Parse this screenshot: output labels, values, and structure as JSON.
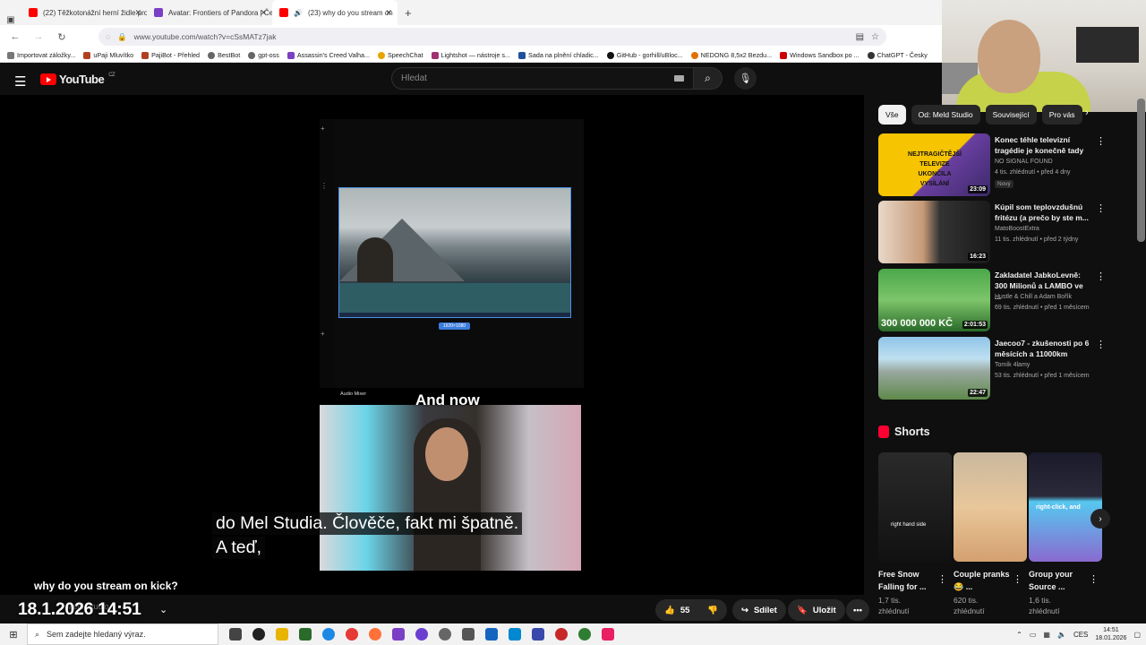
{
  "browser": {
    "tabs": [
      {
        "label": "(22) Těžkotonážní herní židle pro",
        "color": "#ff0000",
        "active": false
      },
      {
        "label": "Avatar: Frontiers of Pandora | Če",
        "color": "#7a3fc4",
        "active": false
      },
      {
        "label": "(23) why do you stream on",
        "color": "#ff0000",
        "active": true
      }
    ],
    "new_tab": "+",
    "url": "www.youtube.com/watch?v=cSsMATz7jak",
    "bookmarks": [
      {
        "label": "Importovat záložky...",
        "color": "#777"
      },
      {
        "label": "uPaji Mluvítko",
        "color": "#b04020"
      },
      {
        "label": "PajiBot - Přehled",
        "color": "#b04020"
      },
      {
        "label": "BestBot",
        "color": "#666"
      },
      {
        "label": "gpt-oss",
        "color": "#666"
      },
      {
        "label": "Assassin's Creed Valha...",
        "color": "#7a3fc4"
      },
      {
        "label": "SpeechChat",
        "color": "#e8a400"
      },
      {
        "label": "Lightshot — nástroje s...",
        "color": "#a03070"
      },
      {
        "label": "Sada na plnění chladic...",
        "color": "#2050a0"
      },
      {
        "label": "GitHub - gorhill/uBloc...",
        "color": "#111"
      },
      {
        "label": "NEDONG 8,5x2 Bezdu...",
        "color": "#e07000"
      },
      {
        "label": "Windows Sandbox po ...",
        "color": "#c00"
      },
      {
        "label": "ChatGPT - Česky",
        "color": "#333"
      }
    ]
  },
  "youtube": {
    "logo": "YouTube",
    "region": "CZ",
    "search_placeholder": "Hledat"
  },
  "player": {
    "overlay_text": "And now",
    "resolution_badge": "1920×1080",
    "audio_mixer": "Audio Mixer",
    "subtitle_lines": [
      "do Mel Studia.  Člověče, fakt mi špatně.",
      "A teď,"
    ]
  },
  "video": {
    "title": "why do you stream on kick?",
    "clock": "18.1.2026 14:51",
    "channel_ghost": "Meld Studio",
    "likes": "55",
    "share": "Sdílet",
    "save": "Uložit",
    "more": "•••"
  },
  "sidebar": {
    "chips": [
      "Vše",
      "Od: Meld Studio",
      "Související",
      "Pro vás"
    ],
    "recommendations": [
      {
        "title": "Konec téhle televizní tragédie je konečně tady",
        "channel": "NO SIGNAL FOUND",
        "meta": "4 tis. zhlédnutí • před 4 dny",
        "badge": "Nový",
        "duration": "23:09",
        "thumb_text": "NEJTRAGIČTĚJŠÍ TELEVIZE UKONČILA VYSÍLÁNÍ"
      },
      {
        "title": "Kúpil som teplovzdušnú fritézu (a prečo by ste m...",
        "channel": "MatoBoostExtra",
        "meta": "11 tis. zhlédnutí • před 2 týdny",
        "badge": "",
        "duration": "16:23",
        "thumb_text": ""
      },
      {
        "title": "Zakladatel JabkoLevně: 300 Milionů a LAMBO ve ...",
        "channel": "Hustle & Chill a Adam Bořík",
        "meta": "69 tis. zhlédnutí • před 1 měsícem",
        "badge": "",
        "duration": "2:01:53",
        "thumb_text": "300 000 000 KČ"
      },
      {
        "title": "Jaecoo7 - zkušenosti po 6 měsících a 11000km",
        "channel": "Tomík 4lamy",
        "meta": "53 tis. zhlédnutí • před 1 měsícem",
        "badge": "",
        "duration": "22:47",
        "thumb_text": ""
      }
    ],
    "shorts_heading": "Shorts",
    "shorts": [
      {
        "title": "Free Snow Falling for ...",
        "views": "1,7 tis. zhlédnutí",
        "thumb_text": "right hand side"
      },
      {
        "title": "Couple pranks 😂 ...",
        "views": "620 tis. zhlédnutí",
        "thumb_text": ""
      },
      {
        "title": "Group your Source ...",
        "views": "1,6 tis. zhlédnutí",
        "thumb_text": "right-click, and"
      }
    ]
  },
  "taskbar": {
    "search_placeholder": "Sem zadejte hledaný výraz.",
    "language": "CES",
    "time": "14:51",
    "date": "18.01.2026"
  }
}
